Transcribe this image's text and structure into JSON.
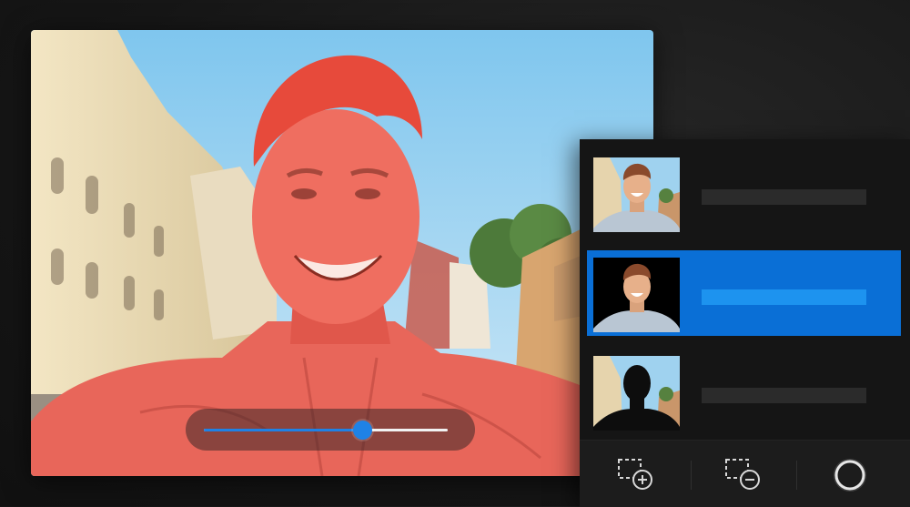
{
  "canvas": {
    "image": "selfie-photo",
    "overlay_color": "#ff4a3d",
    "opacity_slider": {
      "value": 0.65,
      "track_color": "#f2f2f2",
      "accent": "#1f82e6"
    }
  },
  "layers_panel": {
    "selected_index": 1,
    "layers": [
      {
        "name": "",
        "thumbnail": "original-photo"
      },
      {
        "name": "",
        "thumbnail": "person-cutout"
      },
      {
        "name": "",
        "thumbnail": "background-only"
      }
    ],
    "accent": "#0a6fd6"
  },
  "toolbar": {
    "tools": [
      {
        "icon": "add-selection-icon"
      },
      {
        "icon": "subtract-selection-icon"
      },
      {
        "icon": "circle-brush-icon"
      }
    ]
  }
}
